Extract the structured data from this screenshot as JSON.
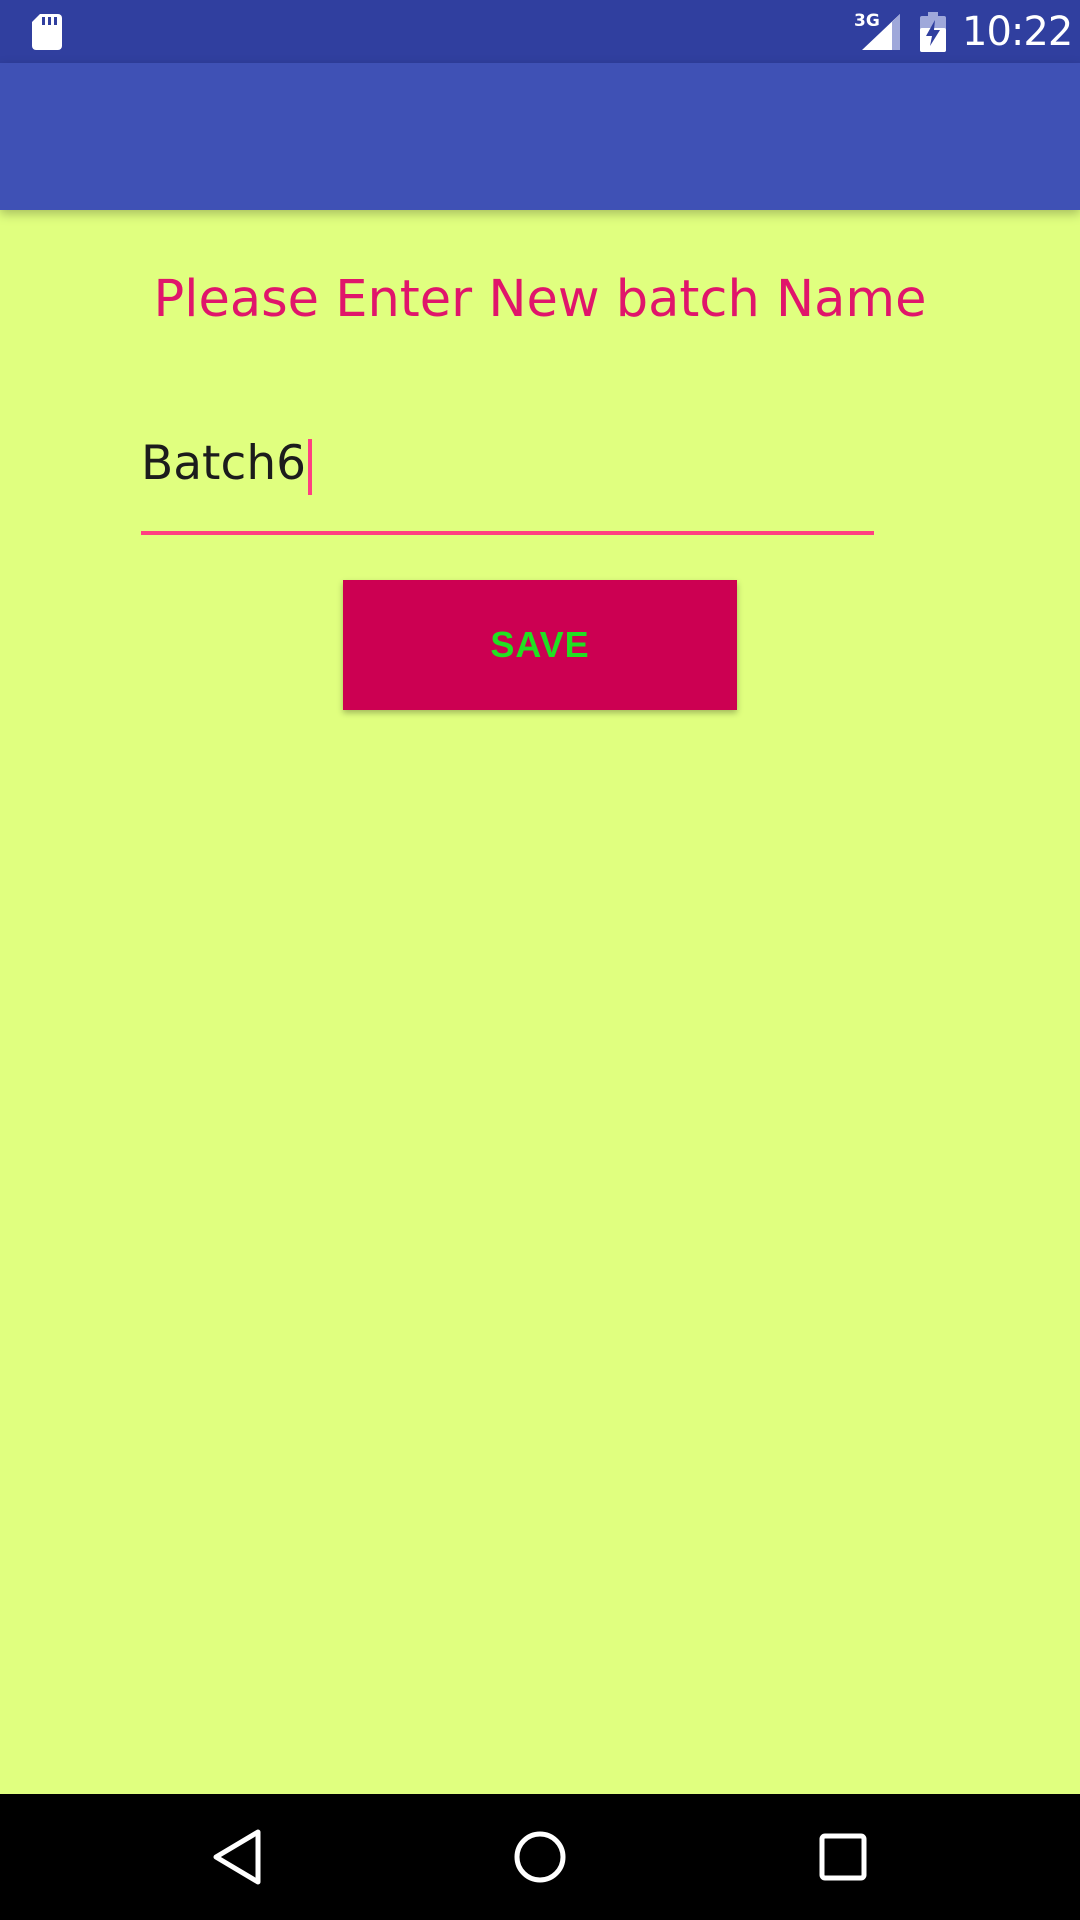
{
  "status_bar": {
    "time": "10:22",
    "network": "3G",
    "icons": [
      "sd-card-icon",
      "signal-icon",
      "battery-icon"
    ]
  },
  "app_bar": {
    "title": ""
  },
  "form": {
    "prompt": "Please Enter New batch Name",
    "batch_name_value": "Batch6",
    "save_label": "SAVE"
  },
  "nav_bar": {
    "icons": [
      "back-icon",
      "home-icon",
      "recents-icon"
    ]
  },
  "colors": {
    "background": "#E0FF7F",
    "status_bar": "#303F9F",
    "app_bar": "#3F51B5",
    "prompt_text": "#E0156B",
    "accent": "#FF4081",
    "button_bg": "#CC0052",
    "button_text": "#22E022"
  }
}
